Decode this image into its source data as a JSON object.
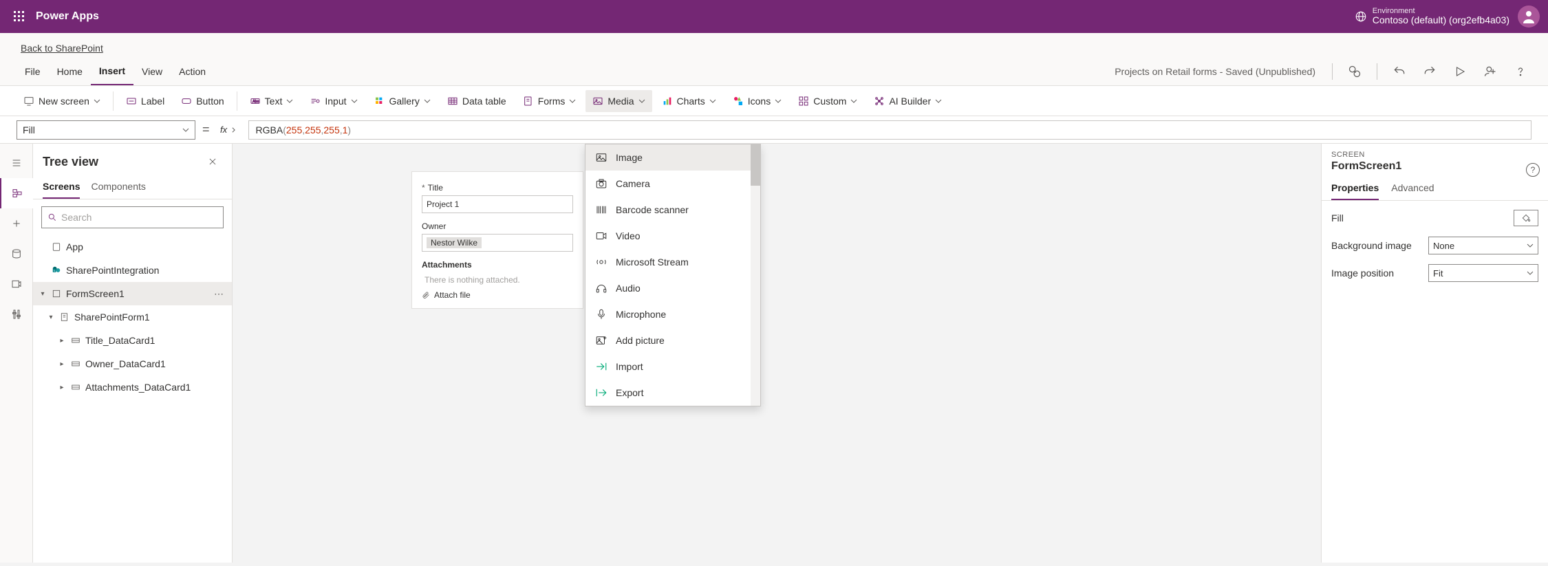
{
  "titlebar": {
    "brand": "Power Apps",
    "env_label": "Environment",
    "env_value": "Contoso (default) (org2efb4a03)"
  },
  "back_link": "Back to SharePoint",
  "menubar": {
    "items": [
      "File",
      "Home",
      "Insert",
      "View",
      "Action"
    ],
    "active_index": 2,
    "doc_status": "Projects on Retail forms - Saved (Unpublished)"
  },
  "ribbon": {
    "new_screen": "New screen",
    "label": "Label",
    "button": "Button",
    "text": "Text",
    "input": "Input",
    "gallery": "Gallery",
    "data_table": "Data table",
    "forms": "Forms",
    "media": "Media",
    "charts": "Charts",
    "icons": "Icons",
    "custom": "Custom",
    "ai_builder": "AI Builder"
  },
  "formula": {
    "property": "Fill",
    "fn": "RGBA",
    "args": [
      "255",
      "255",
      "255",
      "1"
    ]
  },
  "tree": {
    "title": "Tree view",
    "tabs": [
      "Screens",
      "Components"
    ],
    "active_tab": 0,
    "search_placeholder": "Search",
    "nodes": {
      "app": "App",
      "sp_integration": "SharePointIntegration",
      "formscreen": "FormScreen1",
      "spform": "SharePointForm1",
      "title_card": "Title_DataCard1",
      "owner_card": "Owner_DataCard1",
      "attach_card": "Attachments_DataCard1"
    }
  },
  "form_preview": {
    "title_label": "Title",
    "title_value": "Project 1",
    "owner_label": "Owner",
    "owner_value": "Nestor Wilke",
    "attachments_label": "Attachments",
    "attachments_empty": "There is nothing attached.",
    "attach_file": "Attach file"
  },
  "media_menu": {
    "items": [
      "Image",
      "Camera",
      "Barcode scanner",
      "Video",
      "Microsoft Stream",
      "Audio",
      "Microphone",
      "Add picture",
      "Import",
      "Export"
    ]
  },
  "properties": {
    "kicker": "SCREEN",
    "name": "FormScreen1",
    "tabs": [
      "Properties",
      "Advanced"
    ],
    "active_tab": 0,
    "fill_label": "Fill",
    "bg_image_label": "Background image",
    "bg_image_value": "None",
    "img_pos_label": "Image position",
    "img_pos_value": "Fit"
  }
}
